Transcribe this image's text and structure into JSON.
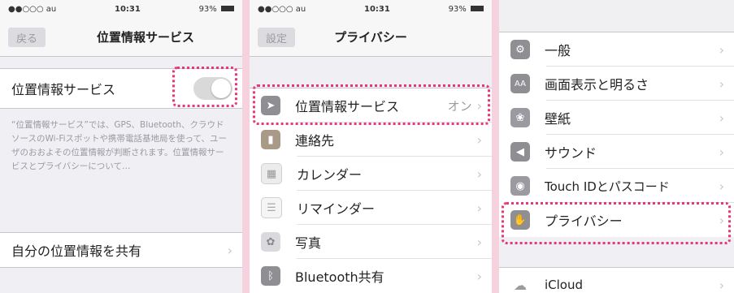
{
  "panel1": {
    "status": {
      "carrier": "●●○○○ au",
      "time": "10:31",
      "battery": "93%"
    },
    "back_label": "戻る",
    "title": "位置情報サービス",
    "toggle_label": "位置情報サービス",
    "toggle_on": false,
    "footnote": "“位置情報サービス”では、GPS、Bluetooth、クラウドソースのWi-Fiスポットや携帯電話基地局を使って、ユーザのおおよその位置情報が判断されます。位置情報サービスとプライバシーについて…",
    "share_label": "自分の位置情報を共有"
  },
  "panel2": {
    "status": {
      "carrier": "●●○○○ au",
      "time": "10:31",
      "battery": "93%"
    },
    "back_label": "設定",
    "title": "プライバシー",
    "items": [
      {
        "label": "位置情報サービス",
        "value": "オン",
        "icon": "location-arrow-icon",
        "color": "#8e8e93"
      },
      {
        "label": "連絡先",
        "value": "",
        "icon": "contacts-icon",
        "color": "#a89a86"
      },
      {
        "label": "カレンダー",
        "value": "",
        "icon": "calendar-icon",
        "color": "#e8e8e8"
      },
      {
        "label": "リマインダー",
        "value": "",
        "icon": "reminders-icon",
        "color": "#e8e8e8"
      },
      {
        "label": "写真",
        "value": "",
        "icon": "photos-icon",
        "color": "#c7c7cc"
      },
      {
        "label": "Bluetooth共有",
        "value": "",
        "icon": "bluetooth-icon",
        "color": "#8e8e93"
      }
    ]
  },
  "panel3": {
    "items": [
      {
        "label": "一般",
        "icon": "gear-icon",
        "color": "#8e8e93"
      },
      {
        "label": "画面表示と明るさ",
        "icon": "display-brightness-icon",
        "color": "#8e8e93"
      },
      {
        "label": "壁紙",
        "icon": "wallpaper-icon",
        "color": "#9a9aa0"
      },
      {
        "label": "サウンド",
        "icon": "sound-icon",
        "color": "#8e8e93"
      },
      {
        "label": "Touch IDとパスコード",
        "icon": "fingerprint-icon",
        "color": "#9a9aa0"
      },
      {
        "label": "プライバシー",
        "icon": "hand-icon",
        "color": "#8e8e93"
      }
    ],
    "icloud_label": "iCloud"
  }
}
